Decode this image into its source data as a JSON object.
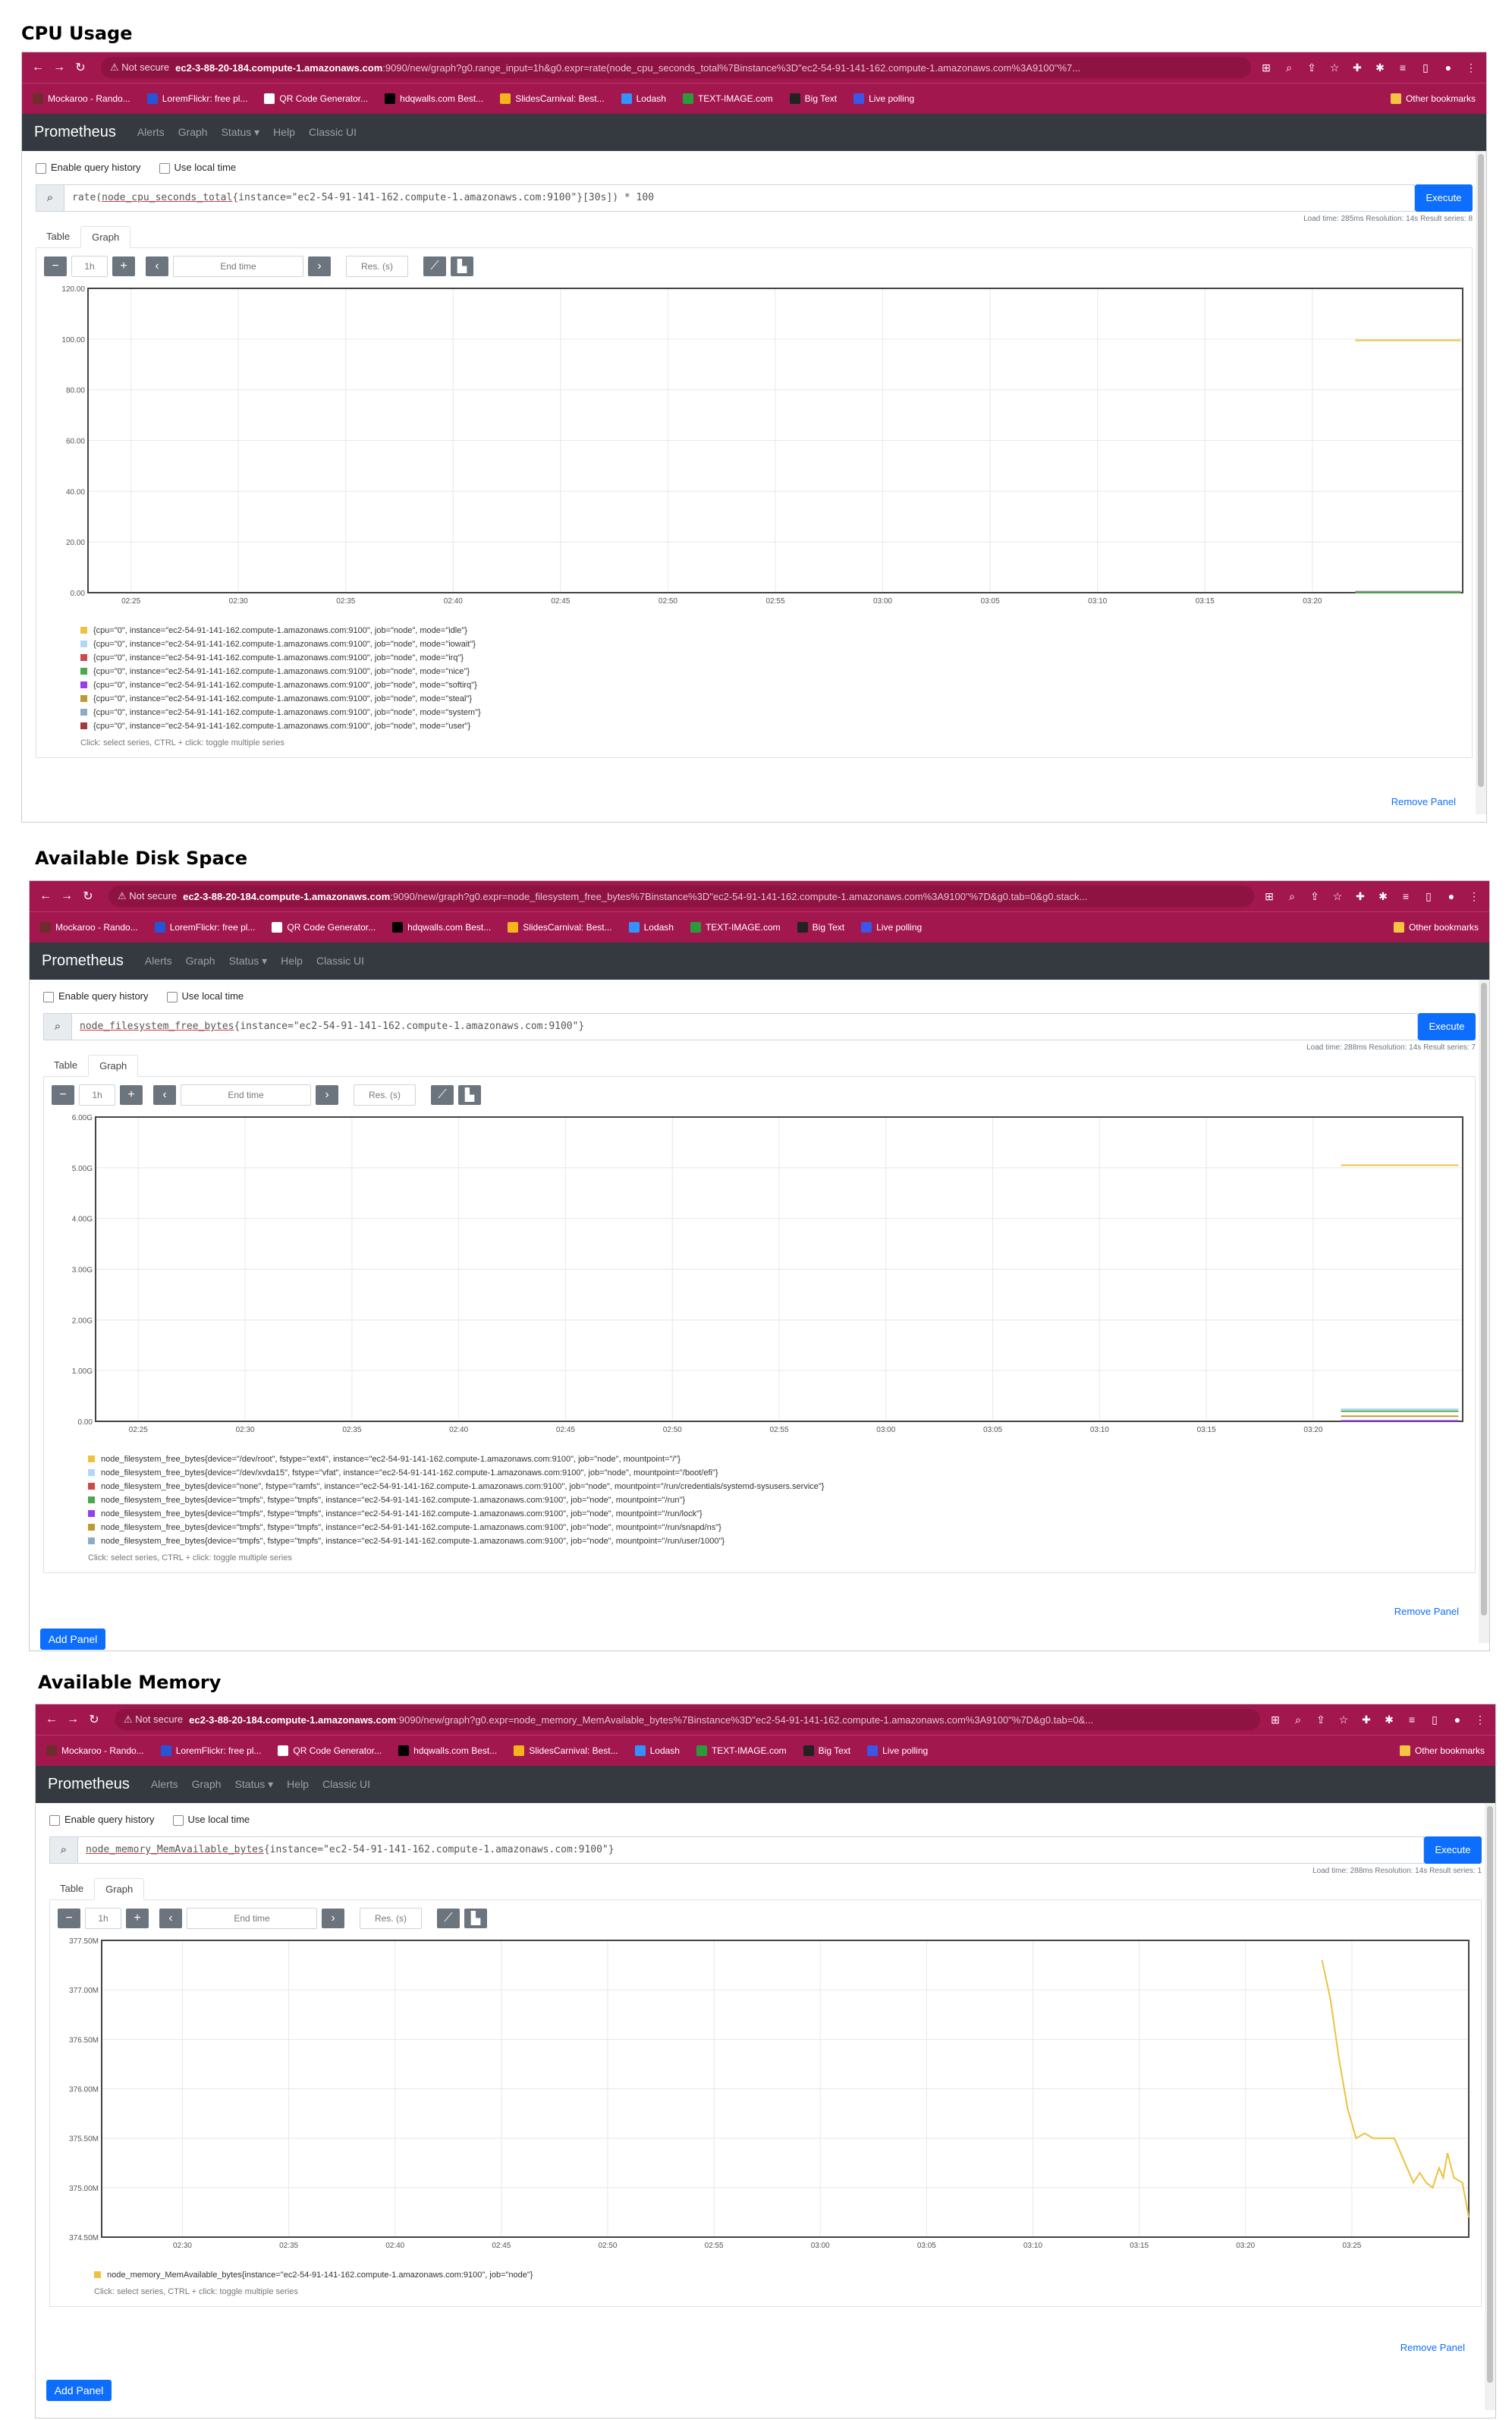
{
  "browser": {
    "not_secure": "Not secure",
    "host": "ec2-3-88-20-184.compute-1.amazonaws.com",
    "bookmarks": [
      {
        "label": "Mockaroo - Rando...",
        "color": "#6f2c2c"
      },
      {
        "label": "LoremFlickr: free pl...",
        "color": "#2456d6"
      },
      {
        "label": "QR Code Generator...",
        "color": "#ffffff"
      },
      {
        "label": "hdqwalls.com Best...",
        "color": "#000000"
      },
      {
        "label": "SlidesCarnival: Best...",
        "color": "#f3b51a"
      },
      {
        "label": "Lodash",
        "color": "#3492ff"
      },
      {
        "label": "TEXT-IMAGE.com",
        "color": "#2b9a3a"
      },
      {
        "label": "Big Text",
        "color": "#222222"
      },
      {
        "label": "Live polling",
        "color": "#3a57e8"
      }
    ],
    "other_bookmarks": "Other bookmarks"
  },
  "prometheus_nav": {
    "brand": "Prometheus",
    "links": [
      "Alerts",
      "Graph",
      "Status ▾",
      "Help",
      "Classic UI"
    ]
  },
  "options": {
    "query_history": "Enable query history",
    "local_time": "Use local time"
  },
  "controls": {
    "execute": "Execute",
    "tab_table": "Table",
    "tab_graph": "Graph",
    "range": "1h",
    "end_time_placeholder": "End time",
    "res_placeholder": "Res. (s)",
    "remove_panel": "Remove Panel",
    "add_panel": "Add Panel",
    "click_hint": "Click: select series, CTRL + click: toggle multiple series"
  },
  "panels": [
    {
      "title": "CPU Usage",
      "url_path": ":9090/new/graph?g0.range_input=1h&g0.expr=rate(node_cpu_seconds_total%7Binstance%3D\"ec2-54-91-141-162.compute-1.amazonaws.com%3A9100\"%7...",
      "query_prefix": "rate(",
      "query_metric": "node_cpu_seconds_total",
      "query_suffix": "{instance=\"ec2-54-91-141-162.compute-1.amazonaws.com:9100\"}[30s]) * 100",
      "stats": "Load time: 285ms   Resolution: 14s   Result series: 8",
      "legend": [
        {
          "text": "{cpu=\"0\", instance=\"ec2-54-91-141-162.compute-1.amazonaws.com:9100\", job=\"node\", mode=\"idle\"}",
          "color": "#edc240"
        },
        {
          "text": "{cpu=\"0\", instance=\"ec2-54-91-141-162.compute-1.amazonaws.com:9100\", job=\"node\", mode=\"iowait\"}",
          "color": "#afd8f8"
        },
        {
          "text": "{cpu=\"0\", instance=\"ec2-54-91-141-162.compute-1.amazonaws.com:9100\", job=\"node\", mode=\"irq\"}",
          "color": "#cb4b4b"
        },
        {
          "text": "{cpu=\"0\", instance=\"ec2-54-91-141-162.compute-1.amazonaws.com:9100\", job=\"node\", mode=\"nice\"}",
          "color": "#4da74d"
        },
        {
          "text": "{cpu=\"0\", instance=\"ec2-54-91-141-162.compute-1.amazonaws.com:9100\", job=\"node\", mode=\"softirq\"}",
          "color": "#9440ed"
        },
        {
          "text": "{cpu=\"0\", instance=\"ec2-54-91-141-162.compute-1.amazonaws.com:9100\", job=\"node\", mode=\"steal\"}",
          "color": "#bd9b33"
        },
        {
          "text": "{cpu=\"0\", instance=\"ec2-54-91-141-162.compute-1.amazonaws.com:9100\", job=\"node\", mode=\"system\"}",
          "color": "#8cacc6"
        },
        {
          "text": "{cpu=\"0\", instance=\"ec2-54-91-141-162.compute-1.amazonaws.com:9100\", job=\"node\", mode=\"user\"}",
          "color": "#a23c3c"
        }
      ]
    },
    {
      "title": "Available Disk Space",
      "url_path": ":9090/new/graph?g0.expr=node_filesystem_free_bytes%7Binstance%3D\"ec2-54-91-141-162.compute-1.amazonaws.com%3A9100\"%7D&g0.tab=0&g0.stack...",
      "query_prefix": "",
      "query_metric": "node_filesystem_free_bytes",
      "query_suffix": "{instance=\"ec2-54-91-141-162.compute-1.amazonaws.com:9100\"}",
      "stats": "Load time: 288ms   Resolution: 14s   Result series: 7",
      "legend": [
        {
          "text": "node_filesystem_free_bytes{device=\"/dev/root\", fstype=\"ext4\", instance=\"ec2-54-91-141-162.compute-1.amazonaws.com:9100\", job=\"node\", mountpoint=\"/\"}",
          "color": "#edc240"
        },
        {
          "text": "node_filesystem_free_bytes{device=\"/dev/xvda15\", fstype=\"vfat\", instance=\"ec2-54-91-141-162.compute-1.amazonaws.com:9100\", job=\"node\", mountpoint=\"/boot/efi\"}",
          "color": "#afd8f8"
        },
        {
          "text": "node_filesystem_free_bytes{device=\"none\", fstype=\"ramfs\", instance=\"ec2-54-91-141-162.compute-1.amazonaws.com:9100\", job=\"node\", mountpoint=\"/run/credentials/systemd-sysusers.service\"}",
          "color": "#cb4b4b"
        },
        {
          "text": "node_filesystem_free_bytes{device=\"tmpfs\", fstype=\"tmpfs\", instance=\"ec2-54-91-141-162.compute-1.amazonaws.com:9100\", job=\"node\", mountpoint=\"/run\"}",
          "color": "#4da74d"
        },
        {
          "text": "node_filesystem_free_bytes{device=\"tmpfs\", fstype=\"tmpfs\", instance=\"ec2-54-91-141-162.compute-1.amazonaws.com:9100\", job=\"node\", mountpoint=\"/run/lock\"}",
          "color": "#9440ed"
        },
        {
          "text": "node_filesystem_free_bytes{device=\"tmpfs\", fstype=\"tmpfs\", instance=\"ec2-54-91-141-162.compute-1.amazonaws.com:9100\", job=\"node\", mountpoint=\"/run/snapd/ns\"}",
          "color": "#bd9b33"
        },
        {
          "text": "node_filesystem_free_bytes{device=\"tmpfs\", fstype=\"tmpfs\", instance=\"ec2-54-91-141-162.compute-1.amazonaws.com:9100\", job=\"node\", mountpoint=\"/run/user/1000\"}",
          "color": "#8cacc6"
        }
      ]
    },
    {
      "title": "Available Memory",
      "url_path": ":9090/new/graph?g0.expr=node_memory_MemAvailable_bytes%7Binstance%3D\"ec2-54-91-141-162.compute-1.amazonaws.com%3A9100\"%7D&g0.tab=0&...",
      "query_prefix": "",
      "query_metric": "node_memory_MemAvailable_bytes",
      "query_suffix": "{instance=\"ec2-54-91-141-162.compute-1.amazonaws.com:9100\"}",
      "stats": "Load time: 288ms   Resolution: 14s   Result series: 1",
      "legend": [
        {
          "text": "node_memory_MemAvailable_bytes{instance=\"ec2-54-91-141-162.compute-1.amazonaws.com:9100\", job=\"node\"}",
          "color": "#edc240"
        }
      ]
    }
  ],
  "chart_data": [
    {
      "type": "line",
      "yticks": [
        "0.00",
        "20.00",
        "40.00",
        "60.00",
        "80.00",
        "100.00",
        "120.00"
      ],
      "ylim": [
        0,
        120
      ],
      "xticks": [
        "02:25",
        "02:30",
        "02:35",
        "02:40",
        "02:45",
        "02:50",
        "02:55",
        "03:00",
        "03:05",
        "03:10",
        "03:15",
        "03:20"
      ],
      "xlim": [
        -2,
        62
      ],
      "series": [
        {
          "color": "#edc240",
          "x": [
            57,
            61.9
          ],
          "values": [
            99.5,
            99.5
          ]
        },
        {
          "color": "#a23c3c",
          "x": [
            57,
            61.9
          ],
          "values": [
            0.4,
            0.4
          ]
        },
        {
          "color": "#8cacc6",
          "x": [
            57,
            61.9
          ],
          "values": [
            0.2,
            0.2
          ]
        },
        {
          "color": "#4da74d",
          "x": [
            57,
            61.9
          ],
          "values": [
            0,
            0
          ]
        }
      ]
    },
    {
      "type": "line",
      "yticks": [
        "0.00",
        "1.00G",
        "2.00G",
        "3.00G",
        "4.00G",
        "5.00G",
        "6.00G"
      ],
      "ylim": [
        0,
        6
      ],
      "xticks": [
        "02:25",
        "02:30",
        "02:35",
        "02:40",
        "02:45",
        "02:50",
        "02:55",
        "03:00",
        "03:05",
        "03:10",
        "03:15",
        "03:20"
      ],
      "xlim": [
        -2,
        62
      ],
      "series": [
        {
          "color": "#edc240",
          "x": [
            56.3,
            61.8
          ],
          "values": [
            5.05,
            5.05
          ]
        },
        {
          "color": "#afd8f8",
          "x": [
            56.3,
            61.8
          ],
          "values": [
            0.24,
            0.24
          ]
        },
        {
          "color": "#4da74d",
          "x": [
            56.3,
            61.8
          ],
          "values": [
            0.2,
            0.2
          ]
        },
        {
          "color": "#bd9b33",
          "x": [
            56.3,
            61.8
          ],
          "values": [
            0.1,
            0.1
          ]
        },
        {
          "color": "#9440ed",
          "x": [
            56.3,
            61.8
          ],
          "values": [
            0.01,
            0.01
          ]
        }
      ]
    },
    {
      "type": "line",
      "yticks": [
        "374.50M",
        "375.00M",
        "375.50M",
        "376.00M",
        "376.50M",
        "377.00M",
        "377.50M"
      ],
      "ylim": [
        374.5,
        377.5
      ],
      "xticks": [
        "02:30",
        "02:35",
        "02:40",
        "02:45",
        "02:50",
        "02:55",
        "03:00",
        "03:05",
        "03:10",
        "03:15",
        "03:20",
        "03:25"
      ],
      "xlim": [
        -3.8,
        60.5
      ],
      "series": [
        {
          "color": "#edc240",
          "x": [
            53.6,
            54.0,
            54.4,
            54.8,
            55.2,
            55.6,
            56.0,
            56.5,
            57.0,
            57.5,
            57.9,
            58.2,
            58.5,
            58.8,
            59.1,
            59.3,
            59.5,
            59.8,
            60.2,
            60.5
          ],
          "values": [
            377.3,
            376.9,
            376.3,
            375.8,
            375.5,
            375.55,
            375.5,
            375.5,
            375.5,
            375.25,
            375.05,
            375.15,
            375.05,
            375.0,
            375.2,
            375.1,
            375.35,
            375.1,
            375.05,
            374.7
          ]
        }
      ]
    }
  ]
}
